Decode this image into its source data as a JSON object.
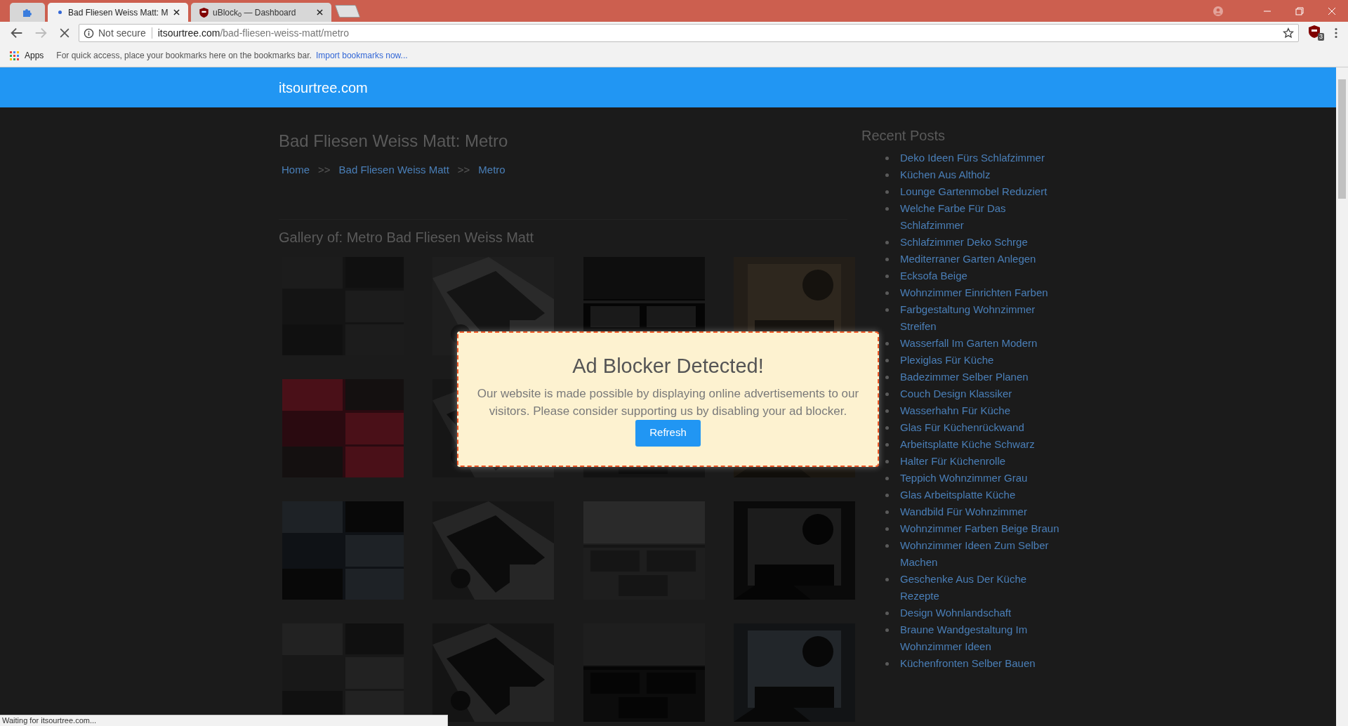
{
  "browser": {
    "tabs": [
      {
        "kind": "extension",
        "selected": false
      },
      {
        "kind": "page",
        "title": "Bad Fliesen Weiss Matt: M",
        "loading": true,
        "selected": true
      },
      {
        "kind": "ublock",
        "title": "uBlock$_{0}$ — Dashboard",
        "loading": false,
        "selected": false
      }
    ],
    "address": {
      "security": "Not secure",
      "host": "itsourtree.com",
      "path": "/bad-fliesen-weiss-matt/metro"
    },
    "extension_badge": "3",
    "bookmarks": {
      "apps": "Apps",
      "hint": "For quick access, place your bookmarks here on the bookmarks bar.",
      "import_link": "Import bookmarks now..."
    },
    "status_bar": "Waiting for itsourtree.com..."
  },
  "page": {
    "site_name": "itsourtree.com",
    "title": "Bad Fliesen Weiss Matt: Metro",
    "breadcrumb": [
      "Home",
      "Bad Fliesen Weiss Matt",
      "Metro"
    ],
    "breadcrumb_separator": ">>",
    "gallery_heading": "Gallery of: Metro Bad Fliesen Weiss Matt",
    "sidebar": {
      "heading": "Recent Posts",
      "posts": [
        "Deko Ideen Fürs Schlafzimmer",
        "Küchen Aus Altholz",
        "Lounge Gartenmobel Reduziert",
        "Welche Farbe Für Das Schlafzimmer",
        "Schlafzimmer Deko Schrge",
        "Mediterraner Garten Anlegen",
        "Ecksofa Beige",
        "Wohnzimmer Einrichten Farben",
        "Farbgestaltung Wohnzimmer Streifen",
        "Wasserfall Im Garten Modern",
        "Plexiglas Für Küche",
        "Badezimmer Selber Planen",
        "Couch Design Klassiker",
        "Wasserhahn Für Küche",
        "Glas Für Küchenrückwand",
        "Arbeitsplatte Küche Schwarz",
        "Halter Für Küchenrolle",
        "Teppich Wohnzimmer Grau",
        "Glas Arbeitsplatte Küche",
        "Wandbild Für Wohnzimmer",
        "Wohnzimmer Farben Beige Braun",
        "Wohnzimmer Ideen Zum Selber Machen",
        "Geschenke Aus Der Küche Rezepte",
        "Design Wohnlandschaft",
        "Braune Wandgestaltung Im Wohnzimmer Ideen",
        "Küchenfronten Selber Bauen"
      ]
    }
  },
  "modal": {
    "title": "Ad Blocker Detected!",
    "message": "Our website is made possible by displaying online advertisements to our visitors. Please consider supporting us by disabling your ad blocker.",
    "button": "Refresh"
  }
}
